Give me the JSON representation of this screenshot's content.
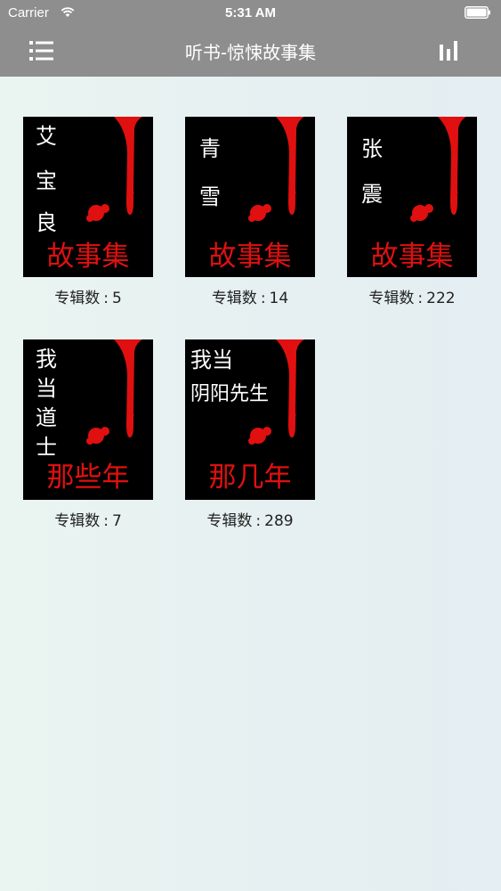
{
  "status_bar": {
    "carrier": "Carrier",
    "time": "5:31 AM"
  },
  "nav": {
    "title": "听书-惊悚故事集",
    "menu_icon": "list-icon",
    "right_icon": "bar-chart-icon"
  },
  "colors": {
    "bar": "#8e8e8e",
    "cover_bg": "#000000",
    "blood": "#e01010",
    "content_bg": "#eaf4f1"
  },
  "albums": [
    {
      "title_lines": [
        "艾",
        "宝",
        "良"
      ],
      "title_layout": "vertical",
      "subtitle": "故事集",
      "count_label": "专辑数",
      "count": "5"
    },
    {
      "title_lines": [
        "青",
        "雪"
      ],
      "title_layout": "vertical",
      "subtitle": "故事集",
      "count_label": "专辑数",
      "count": "14"
    },
    {
      "title_lines": [
        "张",
        "震"
      ],
      "title_layout": "vertical",
      "subtitle": "故事集",
      "count_label": "专辑数",
      "count": "222"
    },
    {
      "title_lines": [
        "我",
        "当",
        "道",
        "士"
      ],
      "title_layout": "vertical",
      "subtitle": "那些年",
      "count_label": "专辑数",
      "count": "7"
    },
    {
      "title_lines": [
        "我当",
        "阴阳先生"
      ],
      "title_layout": "horizontal",
      "subtitle": "那几年",
      "count_label": "专辑数",
      "count": "289"
    }
  ]
}
